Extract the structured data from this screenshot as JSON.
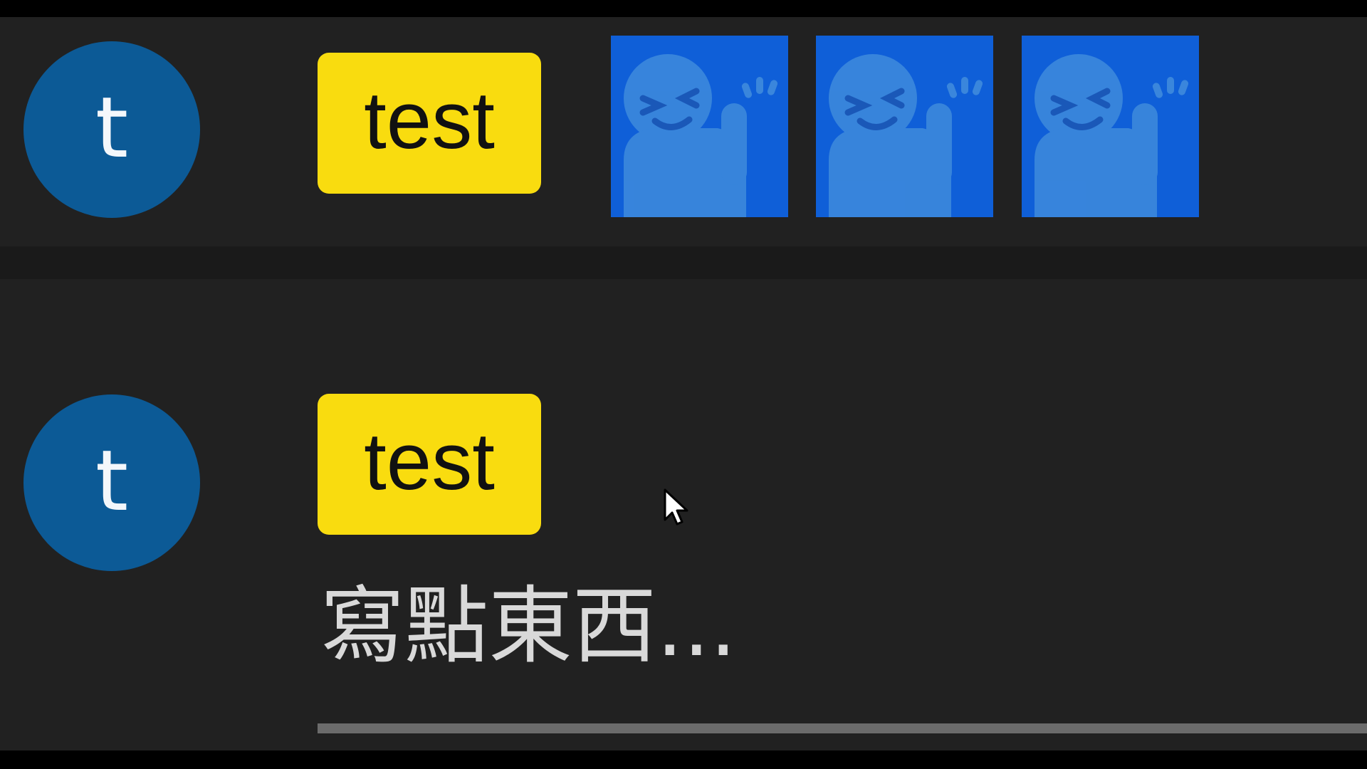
{
  "messages": [
    {
      "avatar_letter": "t",
      "author_label": "test",
      "stickers": [
        {
          "icon": "waving-ghost-sticker"
        },
        {
          "icon": "waving-ghost-sticker"
        },
        {
          "icon": "waving-ghost-sticker"
        }
      ]
    },
    {
      "avatar_letter": "t",
      "author_label": "test"
    }
  ],
  "composer": {
    "placeholder": "寫點東西..."
  },
  "colors": {
    "background": "#212121",
    "avatar": "#0c5a96",
    "badge": "#f9dc0f",
    "sticker_bg": "#0f5fd8"
  }
}
